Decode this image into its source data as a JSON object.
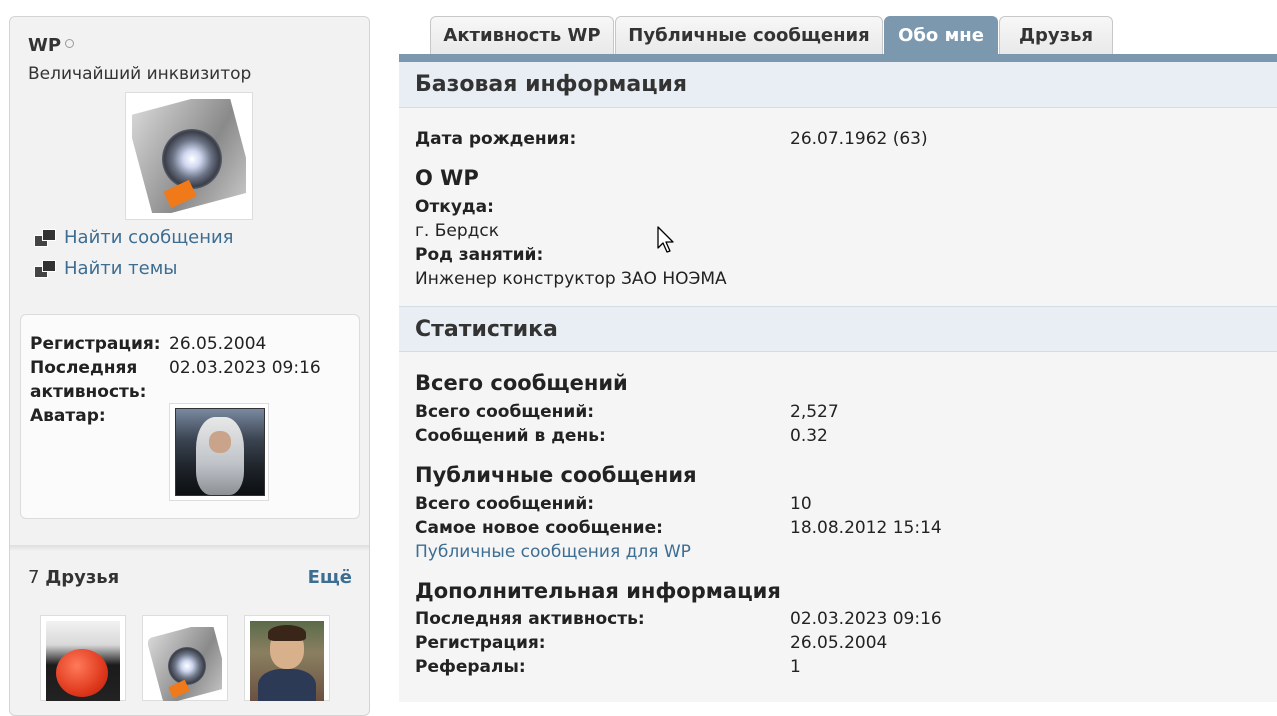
{
  "sidebar": {
    "username": "WP",
    "user_title": "Величайший инквизитор",
    "links": [
      {
        "label": "Найти сообщения"
      },
      {
        "label": "Найти темы"
      }
    ],
    "info": {
      "registration_label": "Регистрация:",
      "registration_value": "26.05.2004",
      "last_activity_label_1": "Последняя",
      "last_activity_label_2": "активность:",
      "last_activity_value": "02.03.2023 09:16",
      "avatar_label": "Аватар:"
    },
    "friends": {
      "count": "7",
      "label": "Друзья",
      "more": "Ещё"
    }
  },
  "tabs": [
    {
      "label": "Активность WP",
      "active": false
    },
    {
      "label": "Публичные сообщения",
      "active": false
    },
    {
      "label": "Обо мне",
      "active": true
    },
    {
      "label": "Друзья",
      "active": false
    }
  ],
  "main": {
    "basic_header": "Базовая информация",
    "birthdate_label": "Дата рождения:",
    "birthdate_value": "26.07.1962 (63)",
    "about_title": "О WP",
    "from_label": "Откуда:",
    "from_value": "г. Бердск",
    "occupation_label": "Род занятий:",
    "occupation_value": "Инженер конструктор ЗАО НОЭМА",
    "stats_header": "Статистика",
    "posts_title": "Всего сообщений",
    "total_posts_label": "Всего сообщений:",
    "total_posts_value": "2,527",
    "posts_per_day_label": "Сообщений в день:",
    "posts_per_day_value": "0.32",
    "vm_title": "Публичные сообщения",
    "vm_total_label": "Всего сообщений:",
    "vm_total_value": "10",
    "vm_latest_label": "Самое новое сообщение:",
    "vm_latest_value": "18.08.2012 15:14",
    "vm_link": "Публичные сообщения для WP",
    "extra_title": "Дополнительная информация",
    "extra_last_activity_label": "Последняя активность:",
    "extra_last_activity_value": "02.03.2023 09:16",
    "extra_registration_label": "Регистрация:",
    "extra_registration_value": "26.05.2004",
    "referrals_label": "Рефералы:",
    "referrals_value": "1"
  },
  "colors": {
    "accent": "#7b98ae",
    "link": "#3e6d92"
  }
}
